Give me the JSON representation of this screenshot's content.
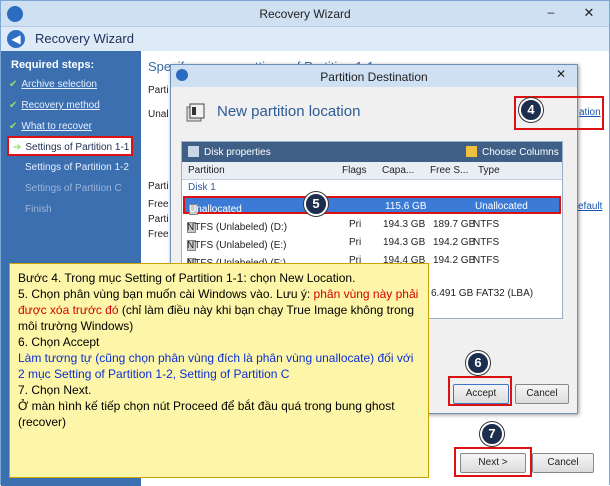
{
  "window": {
    "title": "Recovery Wizard",
    "minimize": "–",
    "close": "✕"
  },
  "header": {
    "title": "Recovery Wizard"
  },
  "sidebar": {
    "heading": "Required steps:",
    "steps": [
      {
        "label": "Archive selection",
        "state": "done"
      },
      {
        "label": "Recovery method",
        "state": "done"
      },
      {
        "label": "What to recover",
        "state": "done"
      },
      {
        "label": "Settings of Partition 1-1",
        "state": "current"
      },
      {
        "label": "Settings of Partition 1-2",
        "state": "pending"
      },
      {
        "label": "Settings of Partition C",
        "state": "dim"
      },
      {
        "label": "Finish",
        "state": "dim"
      }
    ]
  },
  "main": {
    "title": "Specify recover settings of Partition 1-1",
    "labels": [
      "Parti",
      "Unal",
      "Parti",
      "Free",
      "Parti",
      "Free"
    ],
    "link_right": "ation",
    "link_default": "efault"
  },
  "dialog": {
    "title": "Partition Destination",
    "close": "✕",
    "heading": "New partition location",
    "toolbar": {
      "disk_properties": "Disk properties",
      "choose_columns": "Choose Columns"
    },
    "columns": [
      "Partition",
      "Flags",
      "Capa...",
      "Free S...",
      "Type"
    ],
    "group": "Disk 1",
    "rows": [
      {
        "partition": "Unallocated",
        "flags": "",
        "capacity": "115.6 GB",
        "free": "",
        "type": "Unallocated",
        "selected": true
      },
      {
        "partition": "NTFS (Unlabeled) (D:)",
        "flags": "Pri",
        "capacity": "194.3 GB",
        "free": "189.7 GB",
        "type": "NTFS",
        "selected": false
      },
      {
        "partition": "NTFS (Unlabeled) (E:)",
        "flags": "Pri",
        "capacity": "194.3 GB",
        "free": "194.2 GB",
        "type": "NTFS",
        "selected": false
      },
      {
        "partition": "NTFS (Unlabeled) (F:)",
        "flags": "Pri",
        "capacity": "194.4 GB",
        "free": "194.2 GB",
        "type": "NTFS",
        "selected": false
      }
    ],
    "extra_row": "6.491 GB FAT32 (LBA)",
    "accept": "Accept",
    "cancel": "Cancel"
  },
  "footer": {
    "next": "Next >",
    "cancel": "Cancel"
  },
  "badges": [
    "4",
    "5",
    "6",
    "7"
  ],
  "note": {
    "line1": "Bước 4. Trong mục Setting of Partition 1-1: chọn New Location.",
    "line2a": "5. Chọn phân vùng bạn muốn cài Windows vào. Lưu ý: ",
    "line2b": "phân vùng này phải được xóa trước đó",
    "line2c": " (chỉ làm điều này khi bạn chạy True Image không trong môi trường Windows)",
    "line3": "6. Chọn Accept",
    "line4": "Làm tương tự (cũng chọn phân vùng đích là phân vùng unallocate) đối với 2 mục Setting of Partition 1-2, Setting of Partition C",
    "line5": "7. Chọn Next.",
    "line6": "Ở màn hình kế tiếp chọn nút Proceed để bắt đầu quá trong bung ghost (recover)"
  },
  "colors": {
    "accent": "#3b6fb0",
    "highlight": "#d11111",
    "note_bg": "#fdf6a8"
  }
}
